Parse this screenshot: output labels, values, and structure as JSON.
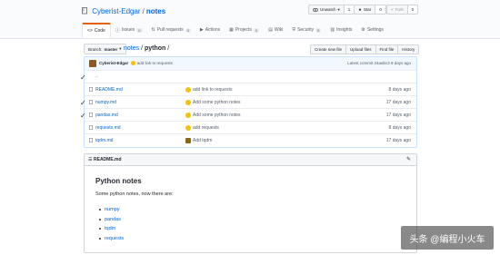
{
  "header": {
    "owner": "Cyberist-Edgar",
    "separator": "/",
    "repo": "notes",
    "watch": {
      "label": "Unwatch",
      "count": "1"
    },
    "star": {
      "label": "Star",
      "count": "0"
    },
    "fork": {
      "label": "Fork",
      "count": "0"
    }
  },
  "tabs": [
    {
      "label": "Code",
      "icon": "code-icon"
    },
    {
      "label": "Issues",
      "count": "0",
      "icon": "issue-icon"
    },
    {
      "label": "Pull requests",
      "count": "0",
      "icon": "pull-request-icon"
    },
    {
      "label": "Actions",
      "icon": "play-icon"
    },
    {
      "label": "Projects",
      "count": "0",
      "icon": "project-icon"
    },
    {
      "label": "Wiki",
      "icon": "book-icon"
    },
    {
      "label": "Security",
      "count": "0",
      "icon": "shield-icon"
    },
    {
      "label": "Insights",
      "icon": "graph-icon"
    },
    {
      "label": "Settings",
      "icon": "gear-icon"
    }
  ],
  "toolbar": {
    "branch_prefix": "Branch:",
    "branch": "master",
    "path_root": "notes",
    "path_sep": "/",
    "path_dir": "python",
    "path_trail": "/",
    "create_file": "Create new file",
    "upload_files": "Upload files",
    "find_file": "Find file",
    "history": "History"
  },
  "commit": {
    "author": "Cyberist-Edgar",
    "message": "add link to requests",
    "latest": "Latest commit 24aabc3 8 days ago"
  },
  "parent_dir": "..",
  "files": [
    {
      "name": "README.md",
      "message": "add link to requests",
      "age": "8 days ago"
    },
    {
      "name": "numpy.md",
      "message": "Add some python notes",
      "age": "17 days ago"
    },
    {
      "name": "pandas.md",
      "message": "Add some python notes",
      "age": "17 days ago"
    },
    {
      "name": "requests.md",
      "message": "add requests",
      "age": "8 days ago"
    },
    {
      "name": "tqdm.md",
      "message": "Add tqdm",
      "age": "17 days ago"
    }
  ],
  "readme": {
    "filename": "README.md",
    "title": "Python notes",
    "intro": "Some python notes, now there are:",
    "links": [
      "numpy",
      "pandas",
      "tqdm",
      "requests"
    ]
  },
  "watermark": "头条 @编程小火车",
  "colors": {
    "link": "#0366d6",
    "accent_tab": "#e36209",
    "commit_bar": "#f1f8ff"
  }
}
